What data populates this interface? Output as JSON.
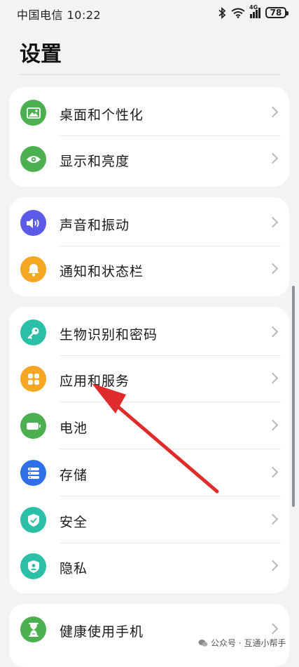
{
  "status_bar": {
    "carrier_time": "中国电信 10:22",
    "signal_label": "4G",
    "battery_level": "78"
  },
  "header": {
    "title": "设置"
  },
  "groups": [
    {
      "items": [
        {
          "label": "桌面和个性化",
          "icon": "wallpaper-icon",
          "color": "#4caf50"
        },
        {
          "label": "显示和亮度",
          "icon": "eye-icon",
          "color": "#4caf50"
        }
      ]
    },
    {
      "items": [
        {
          "label": "声音和振动",
          "icon": "speaker-icon",
          "color": "#5b5be8"
        },
        {
          "label": "通知和状态栏",
          "icon": "bell-icon",
          "color": "#f5a623"
        }
      ]
    },
    {
      "items": [
        {
          "label": "生物识别和密码",
          "icon": "key-icon",
          "color": "#2cbfa8"
        },
        {
          "label": "应用和服务",
          "icon": "apps-icon",
          "color": "#f5a623"
        },
        {
          "label": "电池",
          "icon": "battery-icon",
          "color": "#4caf50"
        },
        {
          "label": "存储",
          "icon": "storage-icon",
          "color": "#2f6fe8"
        },
        {
          "label": "安全",
          "icon": "shield-check-icon",
          "color": "#2cbfa8"
        },
        {
          "label": "隐私",
          "icon": "privacy-shield-icon",
          "color": "#2cbfa8"
        }
      ]
    },
    {
      "items": [
        {
          "label": "健康使用手机",
          "icon": "hourglass-icon",
          "color": "#4caf50"
        }
      ]
    }
  ],
  "watermark": {
    "text": "公众号 · 互通小帮手"
  },
  "annotation": {
    "color": "#e02b2b"
  }
}
